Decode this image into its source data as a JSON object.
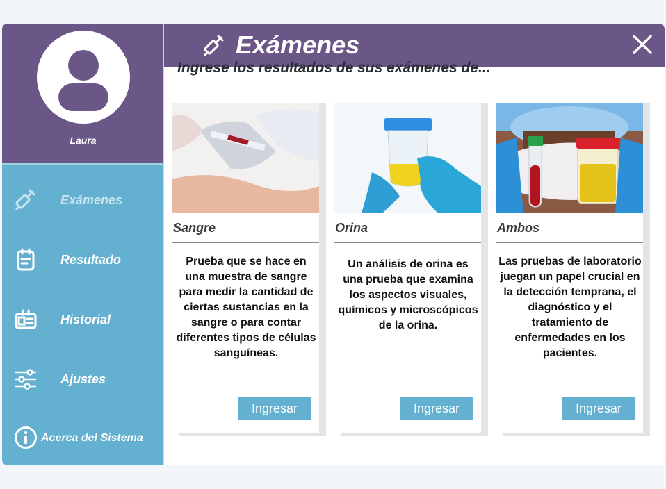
{
  "profile": {
    "username": "Laura"
  },
  "sidebar": {
    "items": [
      {
        "label": "Exámenes",
        "icon": "syringe-icon",
        "active": true
      },
      {
        "label": "Resultado",
        "icon": "clipboard-icon",
        "active": false
      },
      {
        "label": "Historial",
        "icon": "id-card-icon",
        "active": false
      },
      {
        "label": "Ajustes",
        "icon": "sliders-icon",
        "active": false
      }
    ],
    "about": {
      "label": "Acerca del Sistema",
      "icon": "info-icon"
    }
  },
  "header": {
    "title": "Exámenes",
    "icon": "syringe-icon",
    "close_icon": "close-icon"
  },
  "main": {
    "subtitle": "Ingrese los resultados de sus exámenes de...",
    "cards": [
      {
        "title": "Sangre",
        "description": "Prueba que se hace en una muestra de sangre para medir la cantidad de ciertas sustancias en la sangre o para contar diferentes tipos de células sanguíneas.",
        "button": "Ingresar"
      },
      {
        "title": "Orina",
        "description": "Un análisis de orina es una prueba que examina los aspectos visuales, químicos y microscópicos de la orina.",
        "button": "Ingresar"
      },
      {
        "title": "Ambos",
        "description": "Las pruebas de laboratorio juegan un papel crucial en la detección temprana, el diagnóstico y el tratamiento de enfermedades en los pacientes.",
        "button": "Ingresar"
      }
    ]
  },
  "colors": {
    "brand_purple": "#6b5787",
    "sidebar_blue": "#64b0d0",
    "button_blue": "#64b0d0",
    "active_label": "#c6e3ef"
  }
}
